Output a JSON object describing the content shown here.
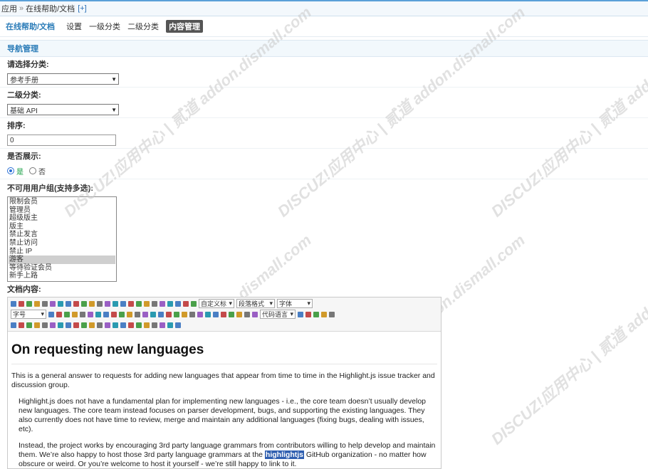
{
  "breadcrumb": {
    "root": "应用",
    "current": "在线帮助/文档",
    "plus": "[+]"
  },
  "subnav": {
    "main": "在线帮助/文档",
    "items": [
      "设置",
      "一级分类",
      "二级分类",
      "内容管理"
    ]
  },
  "section_title": "导航管理",
  "form": {
    "category_label": "请选择分类:",
    "category_value": "参考手册",
    "subcategory_label": "二级分类:",
    "subcategory_value": "基础 API",
    "order_label": "排序:",
    "order_value": "0",
    "show_label": "是否展示:",
    "show_yes": "是",
    "show_no": "否",
    "groups_label": "不可用用户组(支持多选):",
    "groups": [
      "限制会员",
      "管理员",
      "超级版主",
      "版主",
      "禁止发言",
      "禁止访问",
      "禁止 IP",
      "游客",
      "等待验证会员",
      "新手上路"
    ],
    "groups_selected": "游客",
    "content_label": "文档内容:"
  },
  "toolbar": {
    "dd_custom": "自定义标",
    "dd_paragraph": "段落格式",
    "dd_font": "字体",
    "dd_size": "字号",
    "dd_codelang": "代码语言"
  },
  "editor": {
    "heading": "On requesting new languages",
    "p1": "This is a general answer to requests for adding new languages that appear from time to time in the Highlight.js issue tracker and discussion group.",
    "p2": "Highlight.js does not have a fundamental plan for implementing new languages - i.e., the core team doesn’t usually develop new languages. The core team instead focuses on parser development, bugs, and supporting the existing languages. They also currently does not have time to review, merge and maintain any additional languages (fixing bugs, dealing with issues, etc).",
    "p3_a": "Instead, the project works by encouraging 3rd party language grammars from contributors willing to help develop and maintain them. We’re also happy to host those 3rd party language grammars at the ",
    "p3_hl": "highlightjs",
    "p3_b": " GitHub organization - no matter how obscure or weird. Or you’re welcome to host it yourself - we’re still happy to link to it."
  },
  "watermark": "DISCUZ!应用中心 | 贰道 addon.dismall.com"
}
